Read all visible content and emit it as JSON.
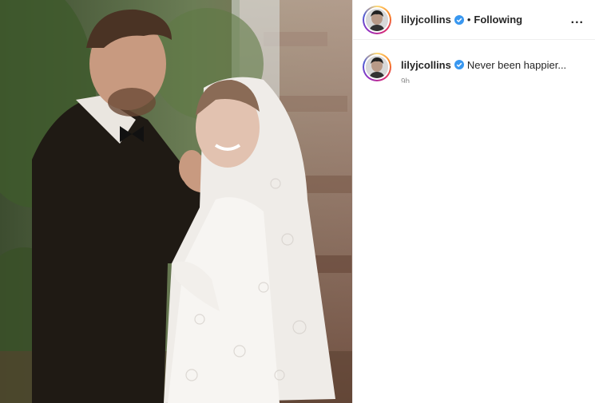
{
  "post": {
    "author": {
      "username": "lilyjcollins",
      "verified": true,
      "avatar_icon": "profile-photo-icon"
    },
    "follow_status": "Following",
    "separator": "•",
    "more_options_label": "...",
    "caption": {
      "username": "lilyjcollins",
      "text": "Never been happier...",
      "timestamp": "9h"
    }
  },
  "colors": {
    "text_primary": "#262626",
    "text_secondary": "#8e8e8e",
    "verified_blue": "#3897f0",
    "divider": "#efefef"
  }
}
